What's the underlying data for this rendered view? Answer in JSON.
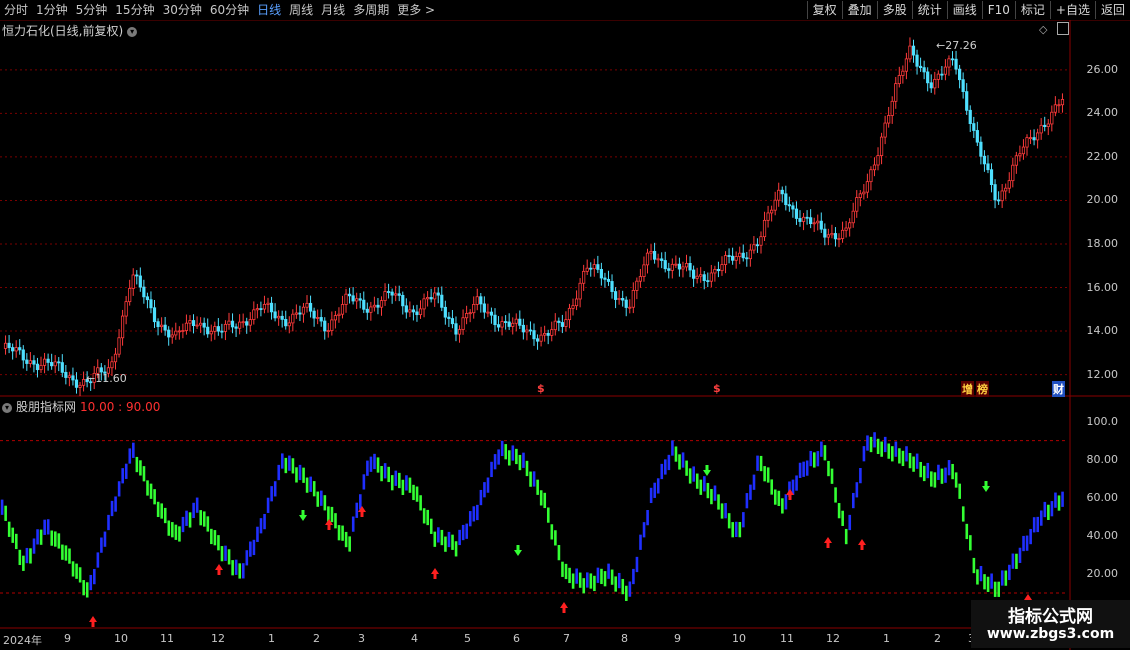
{
  "toolbar": {
    "periods": [
      "分时",
      "1分钟",
      "5分钟",
      "15分钟",
      "30分钟",
      "60分钟",
      "日线",
      "周线",
      "月线",
      "多周期",
      "更多 >"
    ],
    "active_period": "日线",
    "actions": [
      "复权",
      "叠加",
      "多股",
      "统计",
      "画线",
      "F10",
      "标记",
      "+自选",
      "返回"
    ]
  },
  "price_panel": {
    "title": "恒力石化(日线,前复权)",
    "high_label": "27.26",
    "low_label": "11.60",
    "y_ticks": [
      "26.00",
      "24.00",
      "22.00",
      "20.00",
      "18.00",
      "16.00",
      "14.00",
      "12.00"
    ],
    "event_markers": [
      "$",
      "$"
    ],
    "badges": [
      "增",
      "榜",
      "财"
    ]
  },
  "indicator_panel": {
    "title": "股朋指标网",
    "params": "10.00 : 90.00",
    "y_ticks": [
      "100.0",
      "80.00",
      "60.00",
      "40.00",
      "20.00"
    ]
  },
  "date_axis": [
    "2024年",
    "9",
    "10",
    "11",
    "12",
    "1",
    "2",
    "3",
    "4",
    "5",
    "6",
    "7",
    "8",
    "9",
    "10",
    "11",
    "12",
    "1",
    "2",
    "3"
  ],
  "watermark": {
    "title": "指标公式网",
    "url": "www.zbgs3.com"
  },
  "colors": {
    "up": "#ff3b3b",
    "down": "#4fe0ff",
    "indicator_blue": "#1f2fff",
    "indicator_green": "#33ff33",
    "grid": "#7a0000"
  },
  "chart_data": [
    {
      "type": "candlestick",
      "title": "恒力石化(日线,前复权)",
      "ylim": [
        11.2,
        27.6
      ],
      "series": [
        {
          "values": [
            13.2,
            12.8,
            12.5,
            12.0,
            11.6,
            12.3,
            16.5,
            14.8,
            13.6,
            14.6,
            13.8,
            14.5,
            15.0,
            14.6,
            14.9,
            14.3,
            15.4,
            15.2,
            15.6,
            15.0,
            15.5,
            14.2,
            15.2,
            14.5,
            14.0,
            13.9,
            14.2,
            17.2,
            16.0,
            15.3,
            17.6,
            17.0,
            16.5,
            16.8,
            17.4,
            18.2,
            20.5,
            19.0,
            18.6,
            18.5,
            21.0,
            24.0,
            27.2,
            25.0,
            26.8,
            22.5,
            20.1,
            22.0,
            23.5,
            24.5
          ]
        }
      ]
    },
    {
      "type": "bar",
      "title": "股朋指标网",
      "ylim": [
        0,
        105
      ],
      "series": [
        {
          "values": [
            55,
            25,
            45,
            30,
            10,
            50,
            85,
            60,
            40,
            55,
            35,
            20,
            45,
            80,
            70,
            55,
            35,
            80,
            70,
            65,
            40,
            35,
            55,
            85,
            80,
            60,
            20,
            15,
            20,
            10,
            60,
            85,
            70,
            60,
            40,
            80,
            55,
            75,
            85,
            40,
            90,
            85,
            80,
            70,
            75,
            20,
            12,
            30,
            50,
            60
          ]
        }
      ]
    }
  ]
}
